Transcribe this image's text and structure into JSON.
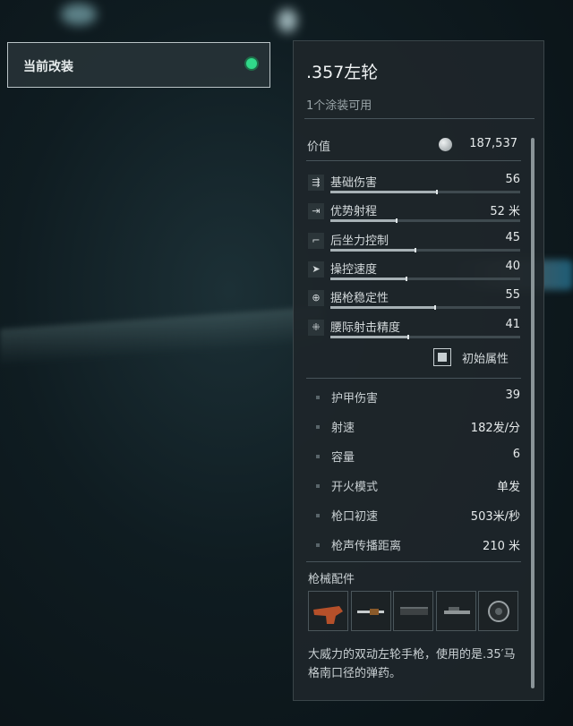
{
  "current_mod": {
    "label": "当前改装"
  },
  "weapon": {
    "name": ".357左轮",
    "skins": "1个涂装可用",
    "value_label": "价值",
    "value": "187,537"
  },
  "stats": [
    {
      "icon": "damage-icon",
      "label": "基础伤害",
      "value": "56",
      "level": 0.56
    },
    {
      "icon": "range-icon",
      "label": "优势射程",
      "value": "52 米",
      "level": 0.35
    },
    {
      "icon": "recoil-icon",
      "label": "后坐力控制",
      "value": "45",
      "level": 0.45
    },
    {
      "icon": "handling-icon",
      "label": "操控速度",
      "value": "40",
      "level": 0.4
    },
    {
      "icon": "crosshair-icon",
      "label": "据枪稳定性",
      "value": "55",
      "level": 0.55
    },
    {
      "icon": "hipfire-icon",
      "label": "腰际射击精度",
      "value": "41",
      "level": 0.41
    }
  ],
  "base_toggle": {
    "label": "初始属性",
    "checked": true
  },
  "attributes": [
    {
      "label": "护甲伤害",
      "value": "39"
    },
    {
      "label": "射速",
      "value": "182发/分"
    },
    {
      "label": "容量",
      "value": "6"
    },
    {
      "label": "开火模式",
      "value": "单发"
    },
    {
      "label": "枪口初速",
      "value": "503米/秒"
    },
    {
      "label": "枪声传播距离",
      "value": "210 米"
    }
  ],
  "parts_title": "枪械配件",
  "parts": [
    "grip-part-icon",
    "barrel-part-icon",
    "rail-part-icon",
    "scope-part-icon",
    "cylinder-part-icon"
  ],
  "description": "大威力的双动左轮手枪，使用的是.35′马格南口径的弹药。",
  "colors": {
    "active_dot": "#31d98a",
    "panel_bg": "#1e262a"
  }
}
